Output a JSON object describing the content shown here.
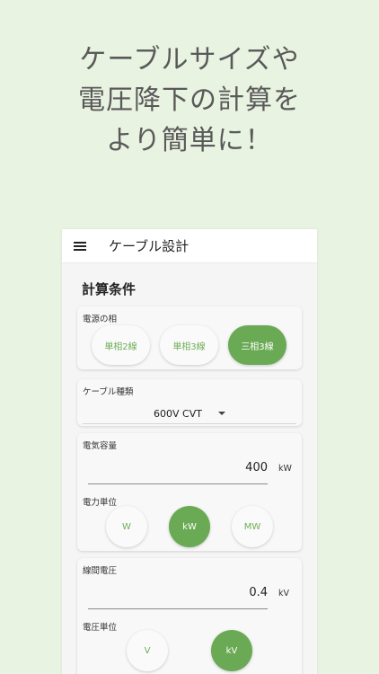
{
  "headline": {
    "lines": [
      "ケーブルサイズや",
      "電圧降下の計算を",
      "より簡単に！"
    ]
  },
  "appbar": {
    "title": "ケーブル設計"
  },
  "section": {
    "title": "計算条件"
  },
  "phase": {
    "label": "電源の相",
    "options": [
      "単相2線",
      "単相3線",
      "三相3線"
    ],
    "selected": "三相3線"
  },
  "cable": {
    "label": "ケーブル種類",
    "value": "600V CVT"
  },
  "capacity": {
    "label": "電気容量",
    "value": "400",
    "unit": "kW",
    "unit_label": "電力単位",
    "unit_options": [
      "W",
      "kW",
      "MW"
    ],
    "selected": "kW"
  },
  "voltage": {
    "label": "線間電圧",
    "value": "0.4",
    "unit": "kV",
    "unit_label": "電圧単位",
    "unit_options": [
      "V",
      "kV"
    ],
    "selected": "kV"
  },
  "colors": {
    "accent": "#6aaa55",
    "background": "#e9f3e1"
  }
}
